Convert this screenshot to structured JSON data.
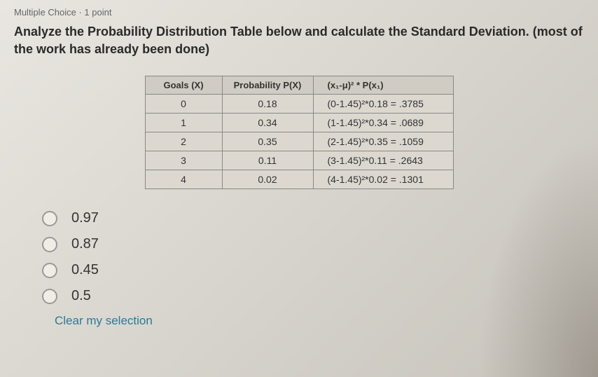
{
  "question": {
    "meta": "Multiple Choice · 1 point",
    "text": "Analyze the Probability Distribution Table below and calculate the Standard Deviation. (most of the work has already been done)"
  },
  "table": {
    "headers": [
      "Goals (X)",
      "Probability P(X)",
      "(x₁-μ)² * P(x₁)"
    ],
    "rows": [
      {
        "x": "0",
        "p": "0.18",
        "calc": "(0-1.45)²*0.18 = .3785"
      },
      {
        "x": "1",
        "p": "0.34",
        "calc": "(1-1.45)²*0.34 = .0689"
      },
      {
        "x": "2",
        "p": "0.35",
        "calc": "(2-1.45)²*0.35 = .1059"
      },
      {
        "x": "3",
        "p": "0.11",
        "calc": "(3-1.45)²*0.11 = .2643"
      },
      {
        "x": "4",
        "p": "0.02",
        "calc": "(4-1.45)²*0.02 = .1301"
      }
    ]
  },
  "options": [
    {
      "label": "0.97"
    },
    {
      "label": "0.87"
    },
    {
      "label": "0.45"
    },
    {
      "label": "0.5"
    }
  ],
  "clear_label": "Clear my selection"
}
